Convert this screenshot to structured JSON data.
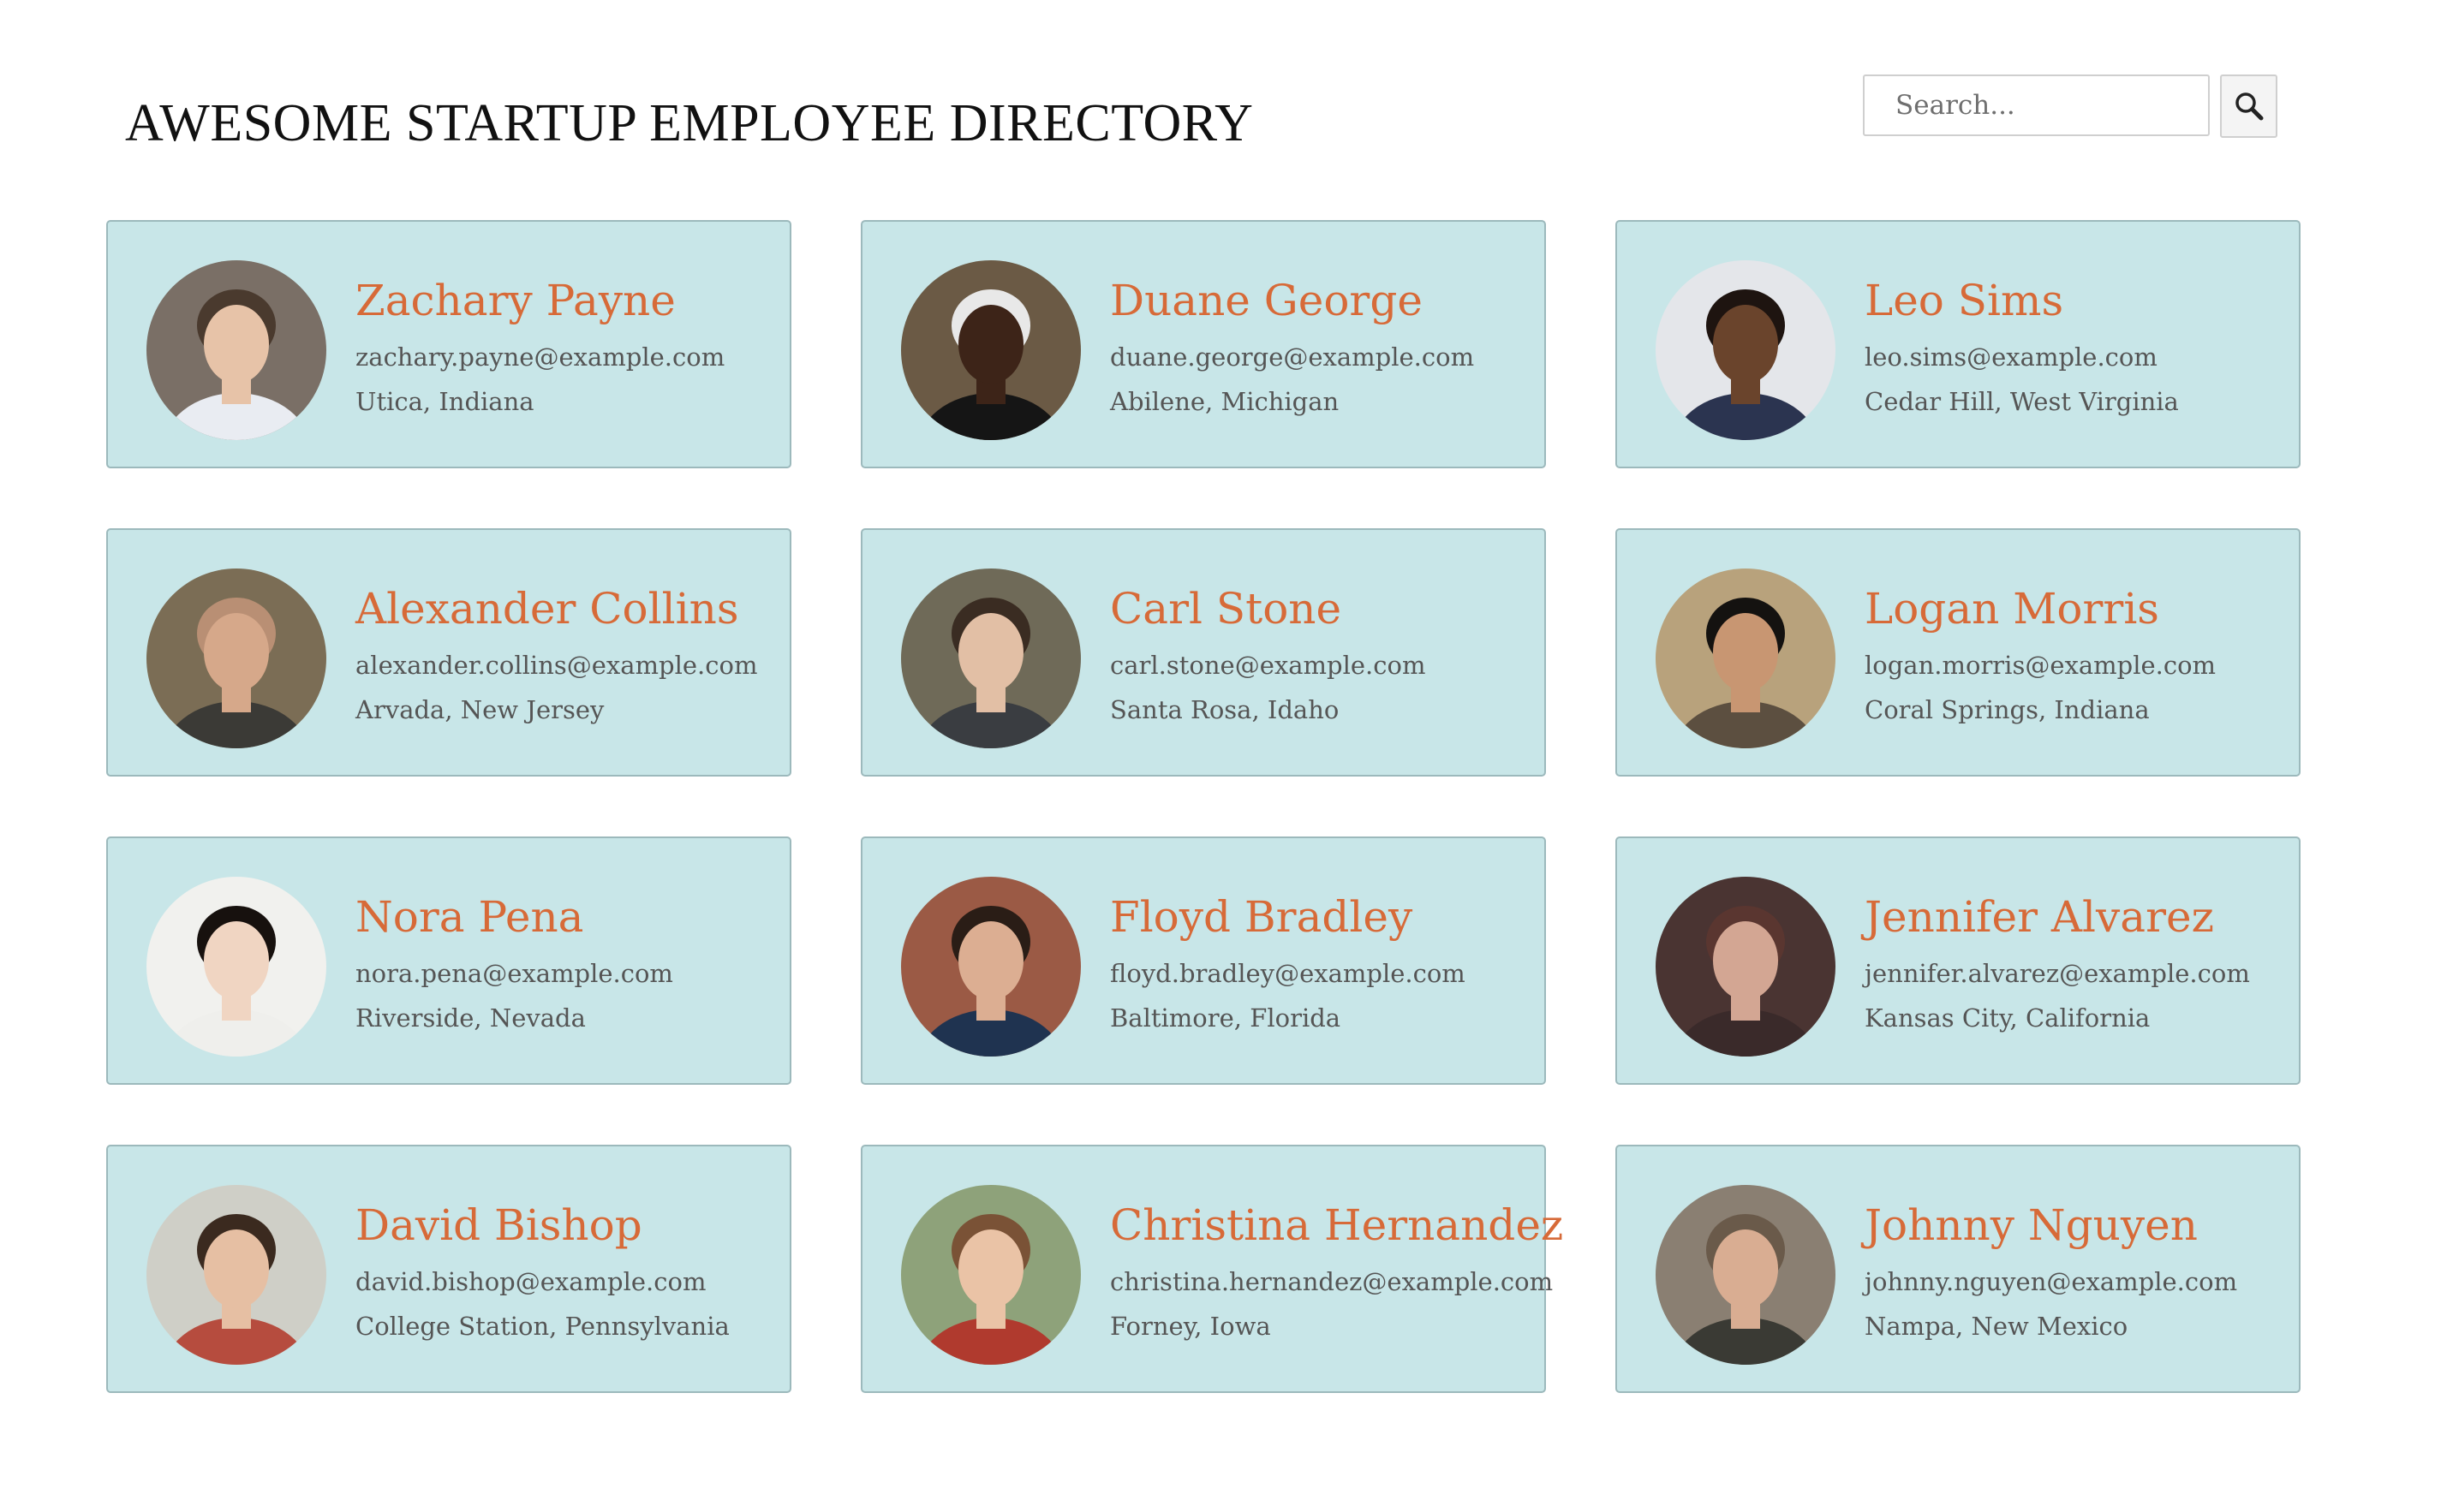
{
  "header": {
    "title": "AWESOME STARTUP EMPLOYEE DIRECTORY"
  },
  "search": {
    "placeholder": "Search...",
    "value": "",
    "button_icon": "magnifier-icon"
  },
  "colors": {
    "card_background": "#c8e6e8",
    "card_border": "#9cb9bc",
    "name": "#d76a38",
    "detail_text": "#555555"
  },
  "employees": [
    {
      "name": "Zachary Payne",
      "email": "zachary.payne@example.com",
      "location": "Utica, Indiana",
      "photo_bg": "#7a6f66",
      "skin": "#e7c3a8",
      "hair": "#4a3a2e",
      "shirt": "#e9ecf2"
    },
    {
      "name": "Duane George",
      "email": "duane.george@example.com",
      "location": "Abilene, Michigan",
      "photo_bg": "#6b5a45",
      "skin": "#3d2418",
      "hair": "#e8e8e8",
      "shirt": "#151515"
    },
    {
      "name": "Leo Sims",
      "email": "leo.sims@example.com",
      "location": "Cedar Hill, West Virginia",
      "photo_bg": "#e4e6ea",
      "skin": "#6a442c",
      "hair": "#1e1410",
      "shirt": "#2b3450"
    },
    {
      "name": "Alexander Collins",
      "email": "alexander.collins@example.com",
      "location": "Arvada, New Jersey",
      "photo_bg": "#7b6d55",
      "skin": "#d6a88a",
      "hair": "#b98f74",
      "shirt": "#3b3a36"
    },
    {
      "name": "Carl Stone",
      "email": "carl.stone@example.com",
      "location": "Santa Rosa, Idaho",
      "photo_bg": "#6f6a58",
      "skin": "#e2bfa5",
      "hair": "#3a2c22",
      "shirt": "#3a3d41"
    },
    {
      "name": "Logan Morris",
      "email": "logan.morris@example.com",
      "location": "Coral Springs, Indiana",
      "photo_bg": "#b8a27c",
      "skin": "#c89672",
      "hair": "#141210",
      "shirt": "#5c4f40"
    },
    {
      "name": "Nora Pena",
      "email": "nora.pena@example.com",
      "location": "Riverside, Nevada",
      "photo_bg": "#f1f1ee",
      "skin": "#f0d5c2",
      "hair": "#17110e",
      "shirt": "#efefec"
    },
    {
      "name": "Floyd Bradley",
      "email": "floyd.bradley@example.com",
      "location": "Baltimore, Florida",
      "photo_bg": "#9b5a45",
      "skin": "#dcae92",
      "hair": "#2a1d16",
      "shirt": "#1f3350"
    },
    {
      "name": "Jennifer Alvarez",
      "email": "jennifer.alvarez@example.com",
      "location": "Kansas City, California",
      "photo_bg": "#4a3432",
      "skin": "#d3a693",
      "hair": "#5a3630",
      "shirt": "#3a2a2a"
    },
    {
      "name": "David Bishop",
      "email": "david.bishop@example.com",
      "location": "College Station, Pennsylvania",
      "photo_bg": "#cfcfc7",
      "skin": "#e6bfa3",
      "hair": "#3b2a1f",
      "shirt": "#b64c3e"
    },
    {
      "name": "Christina Hernandez",
      "email": "christina.hernandez@example.com",
      "location": "Forney, Iowa",
      "photo_bg": "#8ea27a",
      "skin": "#eac3a6",
      "hair": "#7a5236",
      "shirt": "#b03a2e"
    },
    {
      "name": "Johnny Nguyen",
      "email": "johnny.nguyen@example.com",
      "location": "Nampa, New Mexico",
      "photo_bg": "#8a7f72",
      "skin": "#d9ad92",
      "hair": "#6a5a4a",
      "shirt": "#3a3a34"
    }
  ]
}
